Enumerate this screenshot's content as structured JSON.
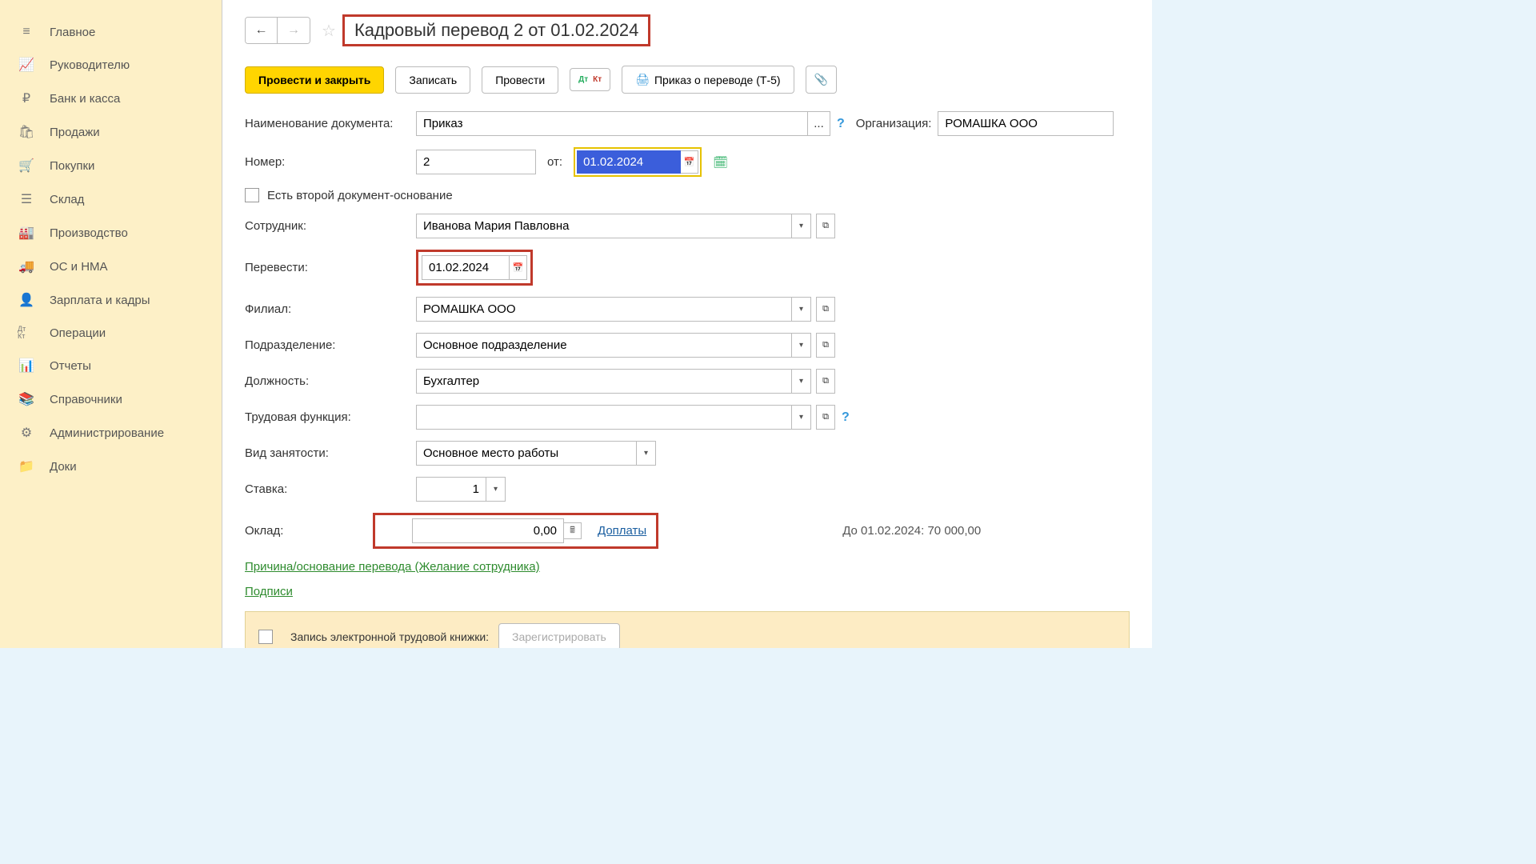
{
  "sidebar": {
    "items": [
      {
        "label": "Главное",
        "icon": "≡"
      },
      {
        "label": "Руководителю",
        "icon": "📈"
      },
      {
        "label": "Банк и касса",
        "icon": "₽"
      },
      {
        "label": "Продажи",
        "icon": "🛍"
      },
      {
        "label": "Покупки",
        "icon": "🛒"
      },
      {
        "label": "Склад",
        "icon": "☰"
      },
      {
        "label": "Производство",
        "icon": "🏭"
      },
      {
        "label": "ОС и НМА",
        "icon": "🚚"
      },
      {
        "label": "Зарплата и кадры",
        "icon": "👤"
      },
      {
        "label": "Операции",
        "icon": "Дт Кт"
      },
      {
        "label": "Отчеты",
        "icon": "📊"
      },
      {
        "label": "Справочники",
        "icon": "📚"
      },
      {
        "label": "Администрирование",
        "icon": "⚙"
      },
      {
        "label": "Доки",
        "icon": "📁"
      }
    ]
  },
  "header": {
    "title": "Кадровый перевод 2 от 01.02.2024"
  },
  "toolbar": {
    "primary": "Провести и закрыть",
    "save": "Записать",
    "post": "Провести",
    "dtkt": "Дт Кт",
    "order": "Приказ о переводе (Т-5)",
    "attach": "📎"
  },
  "form": {
    "docname_label": "Наименование документа:",
    "docname_value": "Приказ",
    "org_label": "Организация:",
    "org_value": "РОМАШКА ООО",
    "number_label": "Номер:",
    "number_value": "2",
    "from_label": "от:",
    "date_value": "01.02.2024",
    "second_doc_label": "Есть второй документ-основание",
    "employee_label": "Сотрудник:",
    "employee_value": "Иванова Мария Павловна",
    "transfer_label": "Перевести:",
    "transfer_date": "01.02.2024",
    "branch_label": "Филиал:",
    "branch_value": "РОМАШКА ООО",
    "dept_label": "Подразделение:",
    "dept_value": "Основное подразделение",
    "position_label": "Должность:",
    "position_value": "Бухгалтер",
    "function_label": "Трудовая функция:",
    "function_value": "",
    "employment_label": "Вид занятости:",
    "employment_value": "Основное место работы",
    "rate_label": "Ставка:",
    "rate_value": "1",
    "salary_label": "Оклад:",
    "salary_value": "0,00",
    "supplements_link": "Доплаты",
    "salary_before": "До 01.02.2024: 70 000,00",
    "reason_link": "Причина/основание перевода (Желание сотрудника)",
    "signatures_link": "Подписи",
    "workbook_label": "Запись электронной трудовой книжки:",
    "register_btn": "Зарегистрировать"
  }
}
